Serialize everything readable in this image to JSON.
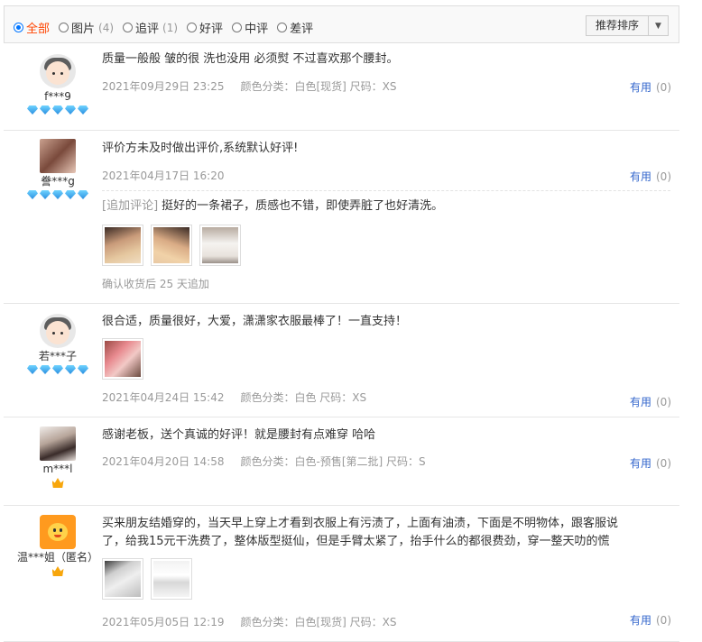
{
  "filters": [
    {
      "label": "全部",
      "count": "",
      "checked": true
    },
    {
      "label": "图片",
      "count": "(4)",
      "checked": false
    },
    {
      "label": "追评",
      "count": "(1)",
      "checked": false
    },
    {
      "label": "好评",
      "count": "",
      "checked": false
    },
    {
      "label": "中评",
      "count": "",
      "checked": false
    },
    {
      "label": "差评",
      "count": "",
      "checked": false
    }
  ],
  "sort": {
    "label": "推荐排序",
    "arrow": "▼"
  },
  "reviews": [
    {
      "user": "f***9",
      "text": "质量一般般 皱的很 洗也没用 必须熨 不过喜欢那个腰封。",
      "date": "2021年09月29日 23:25",
      "spec": "颜色分类：白色[现货]  尺码：XS",
      "useful_label": "有用",
      "useful_count": "(0)"
    },
    {
      "user": "誊***g",
      "text": "评价方未及时做出评价,系统默认好评!",
      "date": "2021年04月17日 16:20",
      "useful_label": "有用",
      "useful_count": "(0)",
      "append_tag": "[追加评论]",
      "append_text": "挺好的一条裙子，质感也不错，即使弄脏了也好清洗。",
      "append_note": "确认收货后 25 天追加"
    },
    {
      "user": "若***子",
      "text": "很合适，质量很好，大爱，潇潇家衣服最棒了！一直支持！",
      "date": "2021年04月24日 15:42",
      "spec": "颜色分类：白色  尺码：XS",
      "useful_label": "有用",
      "useful_count": "(0)"
    },
    {
      "user": "m***l",
      "text": "感谢老板，送个真诚的好评！就是腰封有点难穿 哈哈",
      "date": "2021年04月20日 14:58",
      "spec": "颜色分类：白色-预售[第二批]  尺码：S",
      "useful_label": "有用",
      "useful_count": "(0)"
    },
    {
      "user": "温***姐（匿名）",
      "text_line1": "买来朋友结婚穿的，当天早上穿上才看到衣服上有污渍了，上面有油渍，下面是不明物体，跟客服说",
      "text_line2": "了，给我15元干洗费了，整体版型挺仙，但是手臂太紧了，抬手什么的都很费劲，穿一整天叻的慌",
      "date": "2021年05月05日 12:19",
      "spec": "颜色分类：白色[现货]  尺码：XS",
      "useful_label": "有用",
      "useful_count": "(0)"
    }
  ]
}
